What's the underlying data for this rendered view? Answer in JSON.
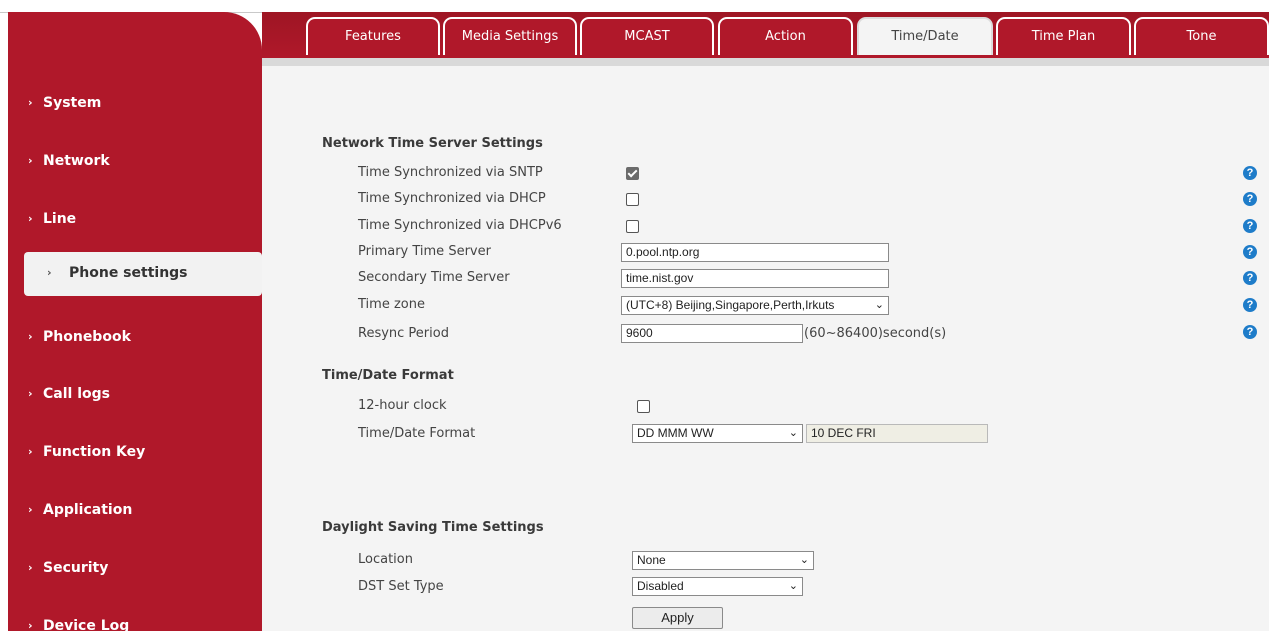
{
  "sidebar": {
    "items": [
      {
        "label": "System"
      },
      {
        "label": "Network"
      },
      {
        "label": "Line"
      },
      {
        "label": "Phone settings"
      },
      {
        "label": "Phonebook"
      },
      {
        "label": "Call logs"
      },
      {
        "label": "Function Key"
      },
      {
        "label": "Application"
      },
      {
        "label": "Security"
      },
      {
        "label": "Device Log"
      }
    ],
    "active_index": 3
  },
  "tabs": [
    {
      "label": "Features"
    },
    {
      "label": "Media Settings"
    },
    {
      "label": "MCAST"
    },
    {
      "label": "Action"
    },
    {
      "label": "Time/Date"
    },
    {
      "label": "Time Plan"
    },
    {
      "label": "Tone"
    }
  ],
  "active_tab_index": 4,
  "network_time": {
    "title": "Network Time Server Settings",
    "sntp_label": "Time Synchronized via SNTP",
    "sntp_checked": true,
    "dhcp_label": "Time Synchronized via DHCP",
    "dhcp_checked": false,
    "dhcpv6_label": "Time Synchronized via DHCPv6",
    "dhcpv6_checked": false,
    "primary_label": "Primary Time Server",
    "primary_value": "0.pool.ntp.org",
    "secondary_label": "Secondary Time Server",
    "secondary_value": "time.nist.gov",
    "timezone_label": "Time zone",
    "timezone_value": "(UTC+8) Beijing,Singapore,Perth,Irkuts",
    "resync_label": "Resync Period",
    "resync_value": "9600",
    "resync_unit": "(60~86400)second(s)"
  },
  "format": {
    "title": "Time/Date Format",
    "clock12_label": "12-hour clock",
    "clock12_checked": false,
    "format_label": "Time/Date Format",
    "format_value": "DD MMM WW",
    "preview_value": "10 DEC FRI"
  },
  "dst": {
    "title": "Daylight Saving Time Settings",
    "location_label": "Location",
    "location_value": "None",
    "type_label": "DST Set Type",
    "type_value": "Disabled"
  },
  "apply_label": "Apply",
  "help_glyph": "?",
  "colors": {
    "brand": "#b0182a",
    "help": "#1e7cc9"
  }
}
